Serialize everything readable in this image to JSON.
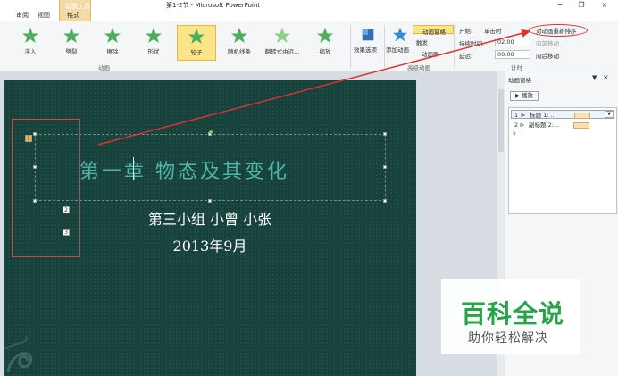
{
  "titlebar": {
    "title": "第1-2节 - Microsoft PowerPoint",
    "tabs": [
      "审阅",
      "视图",
      "格式"
    ],
    "format_group_label": "动画工具",
    "minimize": "−",
    "restore": "❐",
    "close": "×"
  },
  "ribbon": {
    "animations": [
      {
        "label": "浮入"
      },
      {
        "label": "劈裂"
      },
      {
        "label": "擦除"
      },
      {
        "label": "形状"
      },
      {
        "label": "轮子"
      },
      {
        "label": "随机线条"
      },
      {
        "label": "翻转式由远..."
      },
      {
        "label": "缩放"
      }
    ],
    "group_animation_label": "动画",
    "effect_options": "效果选项",
    "add_animation": "添加动画",
    "animation_pane": "动画窗格",
    "trigger": "触发",
    "animation_painter": "动画刷",
    "advanced_group_label": "高级动画",
    "start_label": "开始:",
    "start_value": "单击时",
    "duration_label": "持续时间:",
    "duration_value": "02.00",
    "delay_label": "延迟:",
    "delay_value": "00.00",
    "reorder_label": "对动画重新排序",
    "move_earlier": "向前移动",
    "move_later": "向后移动",
    "timing_group_label": "计时"
  },
  "slide": {
    "title": "第一章  物态及其变化",
    "subtitle_line1": "第三小组 小曾 小张",
    "subtitle_line2": "2013年9月",
    "tag1": "1",
    "tag2": "2",
    "tag3": "3"
  },
  "pane": {
    "title": "动画窗格",
    "play_label": "▶ 播放",
    "rows": [
      {
        "num": "1",
        "label": "标题 1: ..."
      },
      {
        "num": "2",
        "label": "副标题 2:..."
      }
    ]
  },
  "watermark": {
    "big": "百科全说",
    "small": "助你轻松解决"
  },
  "colors": {
    "slide_bg": "#17423c",
    "title_text": "#4fb7a8",
    "selected_anim": "#fbe48a",
    "annotation_red": "#d94040",
    "watermark_green": "#27a34a"
  }
}
